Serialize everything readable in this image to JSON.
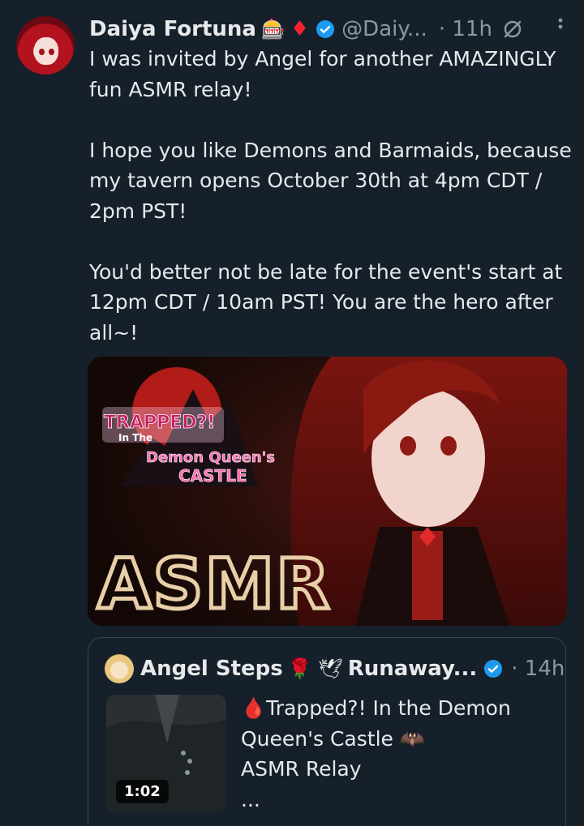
{
  "tweet": {
    "display_name": "Daiya Fortuna",
    "name_emoji": "🎰",
    "name_diamond": "♦",
    "handle": "@Daiy...",
    "time": "· 11h",
    "text": "I was invited by Angel for another AMAZINGLY fun ASMR relay!\n\nI hope you like Demons and Barmaids, because my tavern opens October 30th at 4pm CDT / 2pm PST!\n\nYou'd better not be late for the event's start at 12pm CDT / 10am PST! You are the hero after all~!",
    "icons": [
      "verified-badge",
      "edited-icon",
      "more-icon"
    ]
  },
  "media": {
    "logo_line1": "TRAPPED?!",
    "logo_line2": "In The",
    "logo_line3": "Demon Queen's",
    "logo_line4": "CASTLE",
    "big_text": "ASMR",
    "accent_colors": [
      "#8e1a16",
      "#e8cfa8",
      "#ff6fb4"
    ]
  },
  "quote": {
    "display_name": "Angel Steps",
    "name_emojis": "🌹 🕊",
    "name_suffix": "Runaway...",
    "time": "· 14h",
    "duration": "1:02",
    "text": "🩸Trapped?! In the Demon Queen's Castle 🦇\nASMR Relay\n..."
  },
  "colors": {
    "background": "#15202b",
    "text": "#e7e9ea",
    "muted": "#8b98a5",
    "verified": "#1d9bf0",
    "border": "#38444d"
  }
}
